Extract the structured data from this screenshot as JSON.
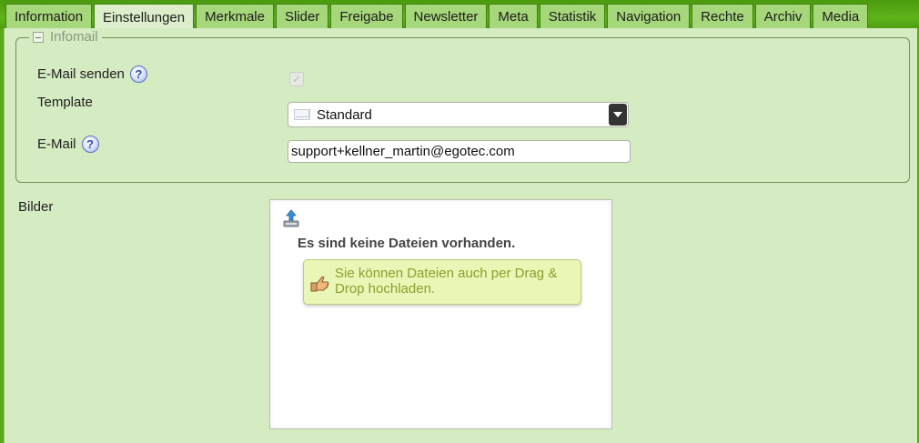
{
  "tabs": [
    {
      "label": "Information",
      "active": false
    },
    {
      "label": "Einstellungen",
      "active": true
    },
    {
      "label": "Merkmale",
      "active": false
    },
    {
      "label": "Slider",
      "active": false
    },
    {
      "label": "Freigabe",
      "active": false
    },
    {
      "label": "Newsletter",
      "active": false
    },
    {
      "label": "Meta",
      "active": false
    },
    {
      "label": "Statistik",
      "active": false
    },
    {
      "label": "Navigation",
      "active": false
    },
    {
      "label": "Rechte",
      "active": false
    },
    {
      "label": "Archiv",
      "active": false
    },
    {
      "label": "Media",
      "active": false
    }
  ],
  "infomail": {
    "legend": "Infomail",
    "collapse_icon": "minus-box-icon",
    "send_email_label": "E-Mail senden",
    "send_email_checked": true,
    "template_label": "Template",
    "template_value": "Standard",
    "email_label": "E-Mail",
    "email_value": "support+kellner_martin@egotec.com",
    "help_glyph": "?"
  },
  "bilder": {
    "label": "Bilder",
    "empty_message": "Es sind keine Dateien vorhanden.",
    "dragdrop_hint": "Sie können Dateien auch per Drag & Drop hochladen.",
    "upload_icon": "upload-icon",
    "hint_icon": "pointing-hand-icon"
  },
  "colors": {
    "header_green": "#5aa815",
    "panel_bg": "#d5ebc2",
    "tab_bg": "#a6d77a",
    "active_tab_bg": "#dceecb",
    "hint_bg": "#e9f6b5",
    "hint_text": "#8aa02e"
  }
}
